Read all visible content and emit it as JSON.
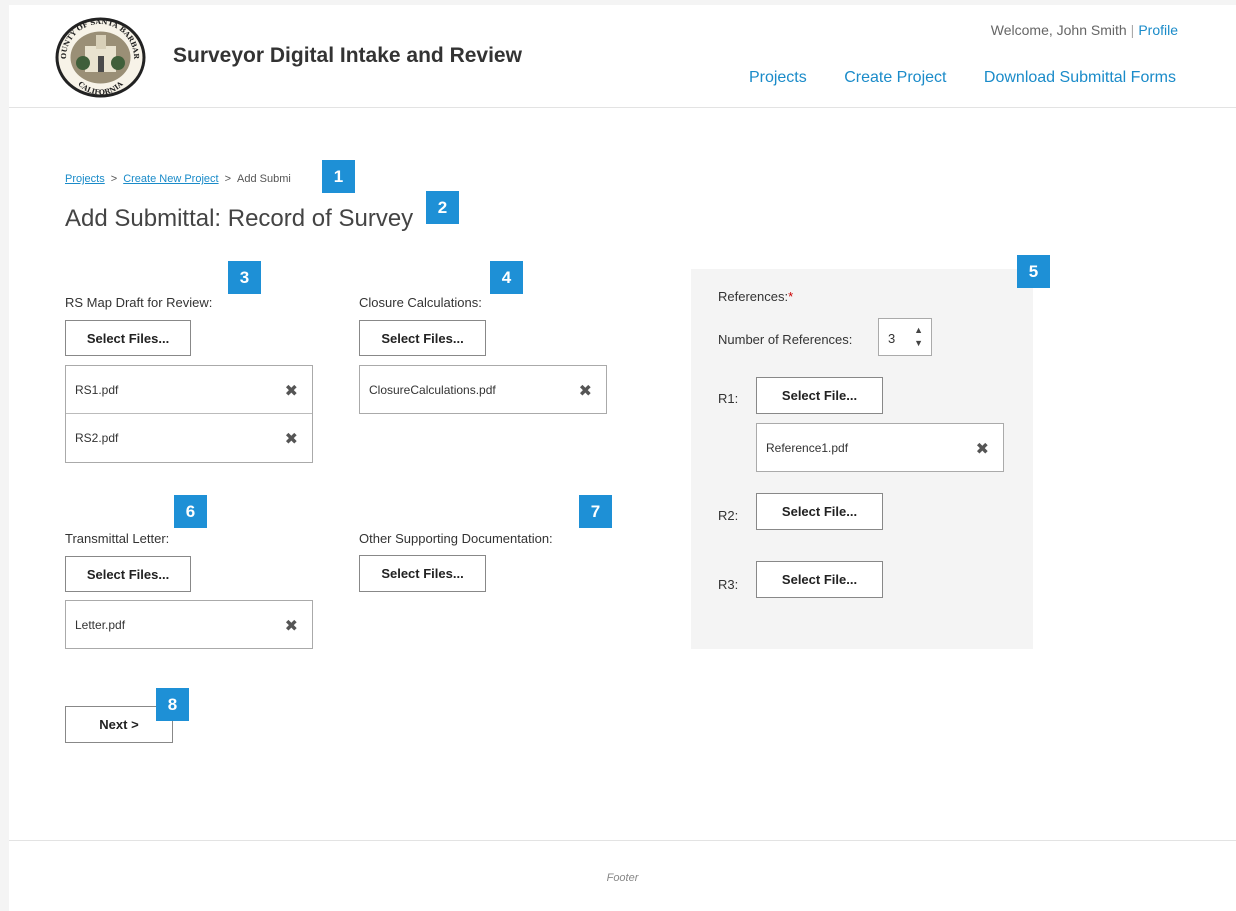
{
  "header": {
    "app_title": "Surveyor Digital Intake and Review",
    "welcome": "Welcome, John Smith",
    "separator": "|",
    "profile_link": "Profile",
    "seal_text_top": "COUNTY OF SANTA BARBARA",
    "seal_text_bottom": "CALIFORNIA",
    "nav": [
      "Projects",
      "Create Project",
      "Download Submittal Forms"
    ]
  },
  "breadcrumb": {
    "items": [
      "Projects",
      "Create New Project"
    ],
    "current": "Add Submi",
    "separator": ">"
  },
  "page_title": "Add Submittal: Record of Survey",
  "sections": {
    "rs_map": {
      "label": "RS Map Draft for Review:",
      "button": "Select Files...",
      "files": [
        "RS1.pdf",
        "RS2.pdf"
      ]
    },
    "closure": {
      "label": "Closure Calculations:",
      "button": "Select Files...",
      "files": [
        "ClosureCalculations.pdf"
      ]
    },
    "transmittal": {
      "label": "Transmittal Letter:",
      "button": "Select Files...",
      "files": [
        "Letter.pdf"
      ]
    },
    "other_docs": {
      "label": "Other Supporting Documentation:",
      "button": "Select Files..."
    }
  },
  "references": {
    "title": "References:",
    "required_mark": "*",
    "count_label": "Number of References:",
    "count_value": "3",
    "items": [
      {
        "label": "R1:",
        "button": "Select File...",
        "file": "Reference1.pdf"
      },
      {
        "label": "R2:",
        "button": "Select File..."
      },
      {
        "label": "R3:",
        "button": "Select File..."
      }
    ]
  },
  "next_button": "Next >",
  "footer": "Footer",
  "callouts": [
    "1",
    "2",
    "3",
    "4",
    "5",
    "6",
    "7",
    "8"
  ],
  "colors": {
    "link": "#1a8bc9",
    "callout": "#1e90d6",
    "panel_bg": "#f4f4f4",
    "required": "#cc0000"
  },
  "icons": {
    "remove": "close-x-icon",
    "spinner_up": "caret-up-icon",
    "spinner_down": "caret-down-icon",
    "logo": "county-seal-logo"
  }
}
